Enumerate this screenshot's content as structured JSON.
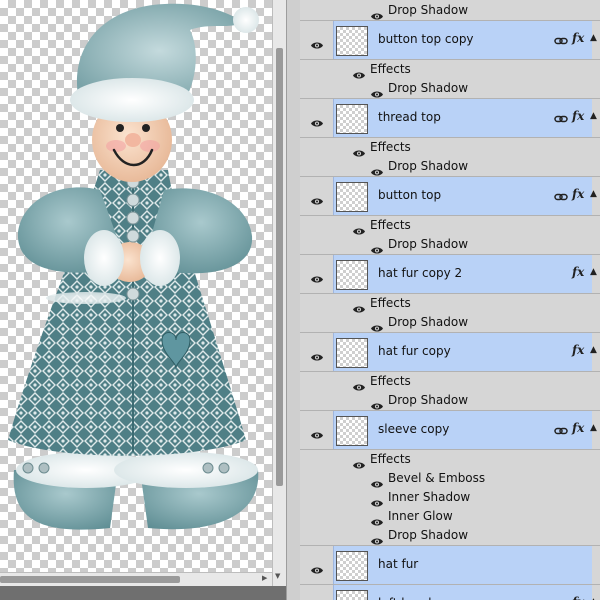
{
  "layers": {
    "top_effect_label": "Drop Shadow",
    "effects_label": "Effects",
    "items": [
      {
        "name": "button top copy",
        "linked": true,
        "fx": true,
        "effects": [
          "Drop Shadow"
        ]
      },
      {
        "name": "thread top",
        "linked": true,
        "fx": true,
        "effects": [
          "Drop Shadow"
        ]
      },
      {
        "name": "button top",
        "linked": true,
        "fx": true,
        "effects": [
          "Drop Shadow"
        ]
      },
      {
        "name": "hat fur copy 2",
        "linked": false,
        "fx": true,
        "effects": [
          "Drop Shadow"
        ]
      },
      {
        "name": "hat fur copy",
        "linked": false,
        "fx": true,
        "effects": [
          "Drop Shadow"
        ]
      },
      {
        "name": "sleeve copy",
        "linked": true,
        "fx": true,
        "effects": [
          "Bevel & Emboss",
          "Inner Shadow",
          "Inner Glow",
          "Drop Shadow"
        ]
      },
      {
        "name": "hat fur",
        "linked": false,
        "fx": false,
        "effects": []
      },
      {
        "name": "left hand",
        "linked": true,
        "fx": true,
        "effects": []
      }
    ]
  },
  "icons": {
    "eye": "eye-icon",
    "link": "link-icon",
    "fx": "fx-icon",
    "collapse": "chevron-up-icon"
  },
  "colors": {
    "selection": "#b9d2f7",
    "panel": "#d6d6d6",
    "figure_teal": "#5f8d93"
  }
}
